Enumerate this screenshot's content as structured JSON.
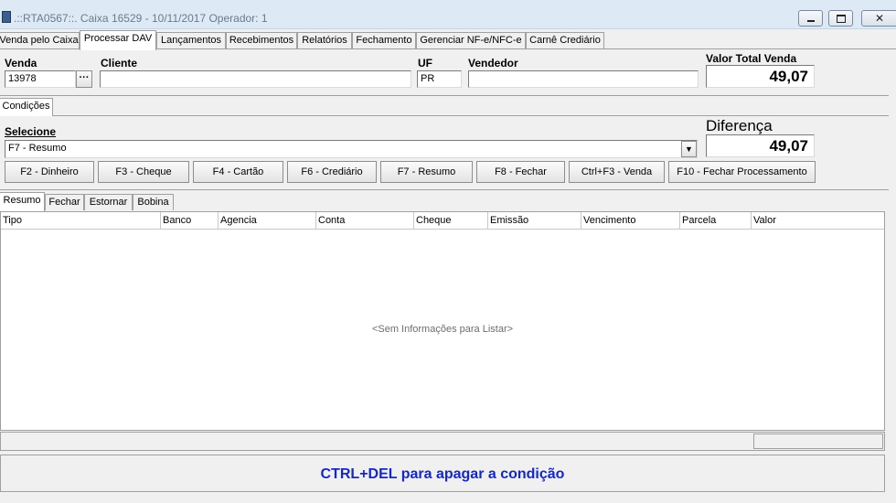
{
  "window": {
    "title": ".::RTA0567::. Caixa 16529 - 10/11/2017 Operador: 1"
  },
  "main_tabs": [
    {
      "label": "Venda pelo Caixa"
    },
    {
      "label": "Processar DAV"
    },
    {
      "label": "Lançamentos"
    },
    {
      "label": "Recebimentos"
    },
    {
      "label": "Relatórios"
    },
    {
      "label": "Fechamento"
    },
    {
      "label": "Gerenciar NF-e/NFC-e"
    },
    {
      "label": "Carnê Crediário"
    }
  ],
  "active_main_tab": "Processar DAV",
  "fields": {
    "venda_label": "Venda",
    "venda_value": "13978",
    "venda_lookup": "···",
    "cliente_label": "Cliente",
    "cliente_value": "",
    "uf_label": "UF",
    "uf_value": "PR",
    "vendedor_label": "Vendedor",
    "vendedor_value": "",
    "valor_total_label": "Valor Total Venda",
    "valor_total_value": "49,07"
  },
  "conditions_tab": {
    "label": "Condições"
  },
  "selecione": {
    "label": "Selecione",
    "selected": "F7 - Resumo",
    "diferenca_label": "Diferença",
    "diferenca_value": "49,07"
  },
  "function_buttons": [
    {
      "label": "F2 - Dinheiro"
    },
    {
      "label": "F3 - Cheque"
    },
    {
      "label": "F4 - Cartão"
    },
    {
      "label": "F6 - Crediário"
    },
    {
      "label": "F7 - Resumo"
    },
    {
      "label": "F8 - Fechar"
    },
    {
      "label": "Ctrl+F3 - Venda"
    },
    {
      "label": "F10 - Fechar Processamento"
    }
  ],
  "sub_tabs": [
    {
      "label": "Resumo"
    },
    {
      "label": "Fechar"
    },
    {
      "label": "Estornar"
    },
    {
      "label": "Bobina"
    }
  ],
  "table": {
    "columns": [
      "Tipo",
      "Banco",
      "Agencia",
      "Conta",
      "Cheque",
      "Emissão",
      "Vencimento",
      "Parcela",
      "Valor"
    ],
    "rows": [],
    "empty_message": "<Sem Informações para Listar>"
  },
  "footer": {
    "hint": "CTRL+DEL para apagar a condição",
    "hint_color": "#1428c8"
  }
}
